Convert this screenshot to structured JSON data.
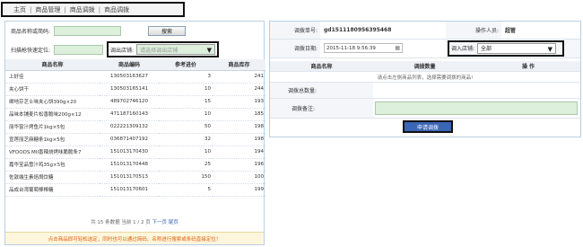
{
  "breadcrumb": [
    "主页",
    "商品管理",
    "商品调拨",
    "商品调拨"
  ],
  "search": {
    "code_label": "商品名称或简码:",
    "code_value": "",
    "search_button": "搜索",
    "scan_label": "扫描枪快速定位:",
    "scan_value": "",
    "out_store_label": "调出店铺:",
    "out_store_placeholder": "请选择调出店铺"
  },
  "product_table": {
    "headers": [
      "商品名称",
      "商品编码",
      "参考进价",
      "商品库存"
    ],
    "rows": [
      {
        "name": "上好佳",
        "code": "130503163627",
        "price": "3",
        "stock": "241"
      },
      {
        "name": "夹心饼干",
        "code": "130503165141",
        "price": "10",
        "stock": "244"
      },
      {
        "name": "卿地芬芝士味夹心饼390g×20",
        "code": "489702746120",
        "price": "15",
        "stock": "193"
      },
      {
        "name": "品味本铺麦片松香脆味200g×12",
        "code": "471187160143",
        "price": "10",
        "stock": "185"
      },
      {
        "name": "丽华窗汁烤鱼片1kg×5包",
        "code": "022221309132",
        "price": "50",
        "stock": "198"
      },
      {
        "name": "宣莲丽芝麻糖条1kg×5包",
        "code": "036871407192",
        "price": "32",
        "stock": "198"
      },
      {
        "name": "VFOODS MII香辣烧烤味脆脆条7",
        "code": "151013170430",
        "price": "10",
        "stock": "194"
      },
      {
        "name": "嘉华宝品雪汁鸡35g×5包",
        "code": "151013170448",
        "price": "25",
        "stock": "196"
      },
      {
        "name": "佐敦端生素焙焗饮糖",
        "code": "151013170513",
        "price": "150",
        "stock": "100"
      },
      {
        "name": "品成台湾葡萄棒棒糖",
        "code": "151013170601",
        "price": "5",
        "stock": "199"
      }
    ],
    "pager": {
      "summary": "共 15 条数据  当前 1 / 2 页",
      "next": "下一页",
      "last": "尾页"
    }
  },
  "hint": "点击商品即可轻松选定，同时也可以通过简码、名称进行搜索或条码直接定位！",
  "order": {
    "no_label": "调拨单号:",
    "no_value": "gd1511180956395468",
    "operator_label": "操作人员:",
    "operator_value": "超管",
    "date_label": "调拨日期:",
    "date_value": "2015-11-18 9:56:39",
    "in_store_label": "调入店铺:",
    "in_store_value": "全部",
    "detail_headers": [
      "商品名称",
      "调拨数量",
      "操 作"
    ],
    "empty_hint": "请点击左侧商品列表，选择需要调拨的商品!",
    "total_label": "调拨总数量:",
    "total_value": "",
    "remark_label": "调拨备注:",
    "remark_value": "",
    "submit_label": "申请调拨"
  }
}
